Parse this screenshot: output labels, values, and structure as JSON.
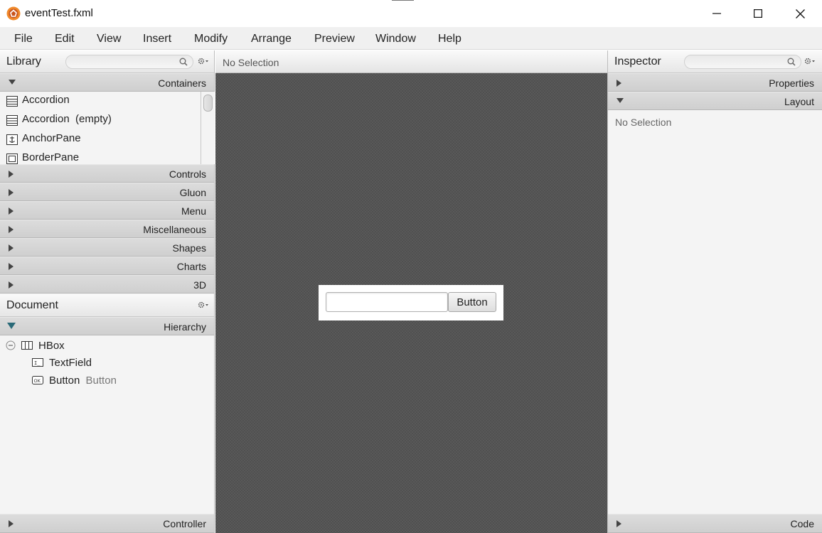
{
  "window": {
    "title": "eventTest.fxml"
  },
  "menu": [
    "File",
    "Edit",
    "View",
    "Insert",
    "Modify",
    "Arrange",
    "Preview",
    "Window",
    "Help"
  ],
  "library": {
    "title": "Library",
    "sections": {
      "containers": "Containers",
      "controls": "Controls",
      "gluon": "Gluon",
      "menu": "Menu",
      "miscellaneous": "Miscellaneous",
      "shapes": "Shapes",
      "charts": "Charts",
      "three_d": "3D"
    },
    "items": [
      {
        "label": "Accordion",
        "icon": "accordion-icon"
      },
      {
        "label": "Accordion  (empty)",
        "icon": "accordion-icon"
      },
      {
        "label": "AnchorPane",
        "icon": "anchorpane-icon"
      },
      {
        "label": "BorderPane",
        "icon": "borderpane-icon"
      }
    ]
  },
  "document": {
    "title": "Document",
    "hierarchy_label": "Hierarchy",
    "controller_label": "Controller",
    "tree": {
      "root": "HBox",
      "children": [
        {
          "label": "TextField",
          "suffix": ""
        },
        {
          "label": "Button",
          "suffix": "Button"
        }
      ]
    }
  },
  "content": {
    "status": "No Selection",
    "button_label": "Button"
  },
  "inspector": {
    "title": "Inspector",
    "properties_label": "Properties",
    "layout_label": "Layout",
    "code_label": "Code",
    "no_selection": "No Selection"
  },
  "colors": {
    "canvas": "#595959",
    "accent_icon": "#e8822a"
  }
}
